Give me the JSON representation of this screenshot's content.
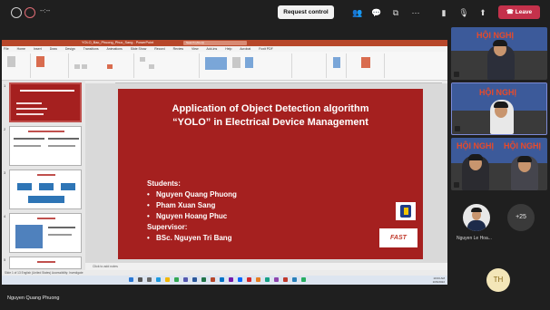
{
  "meeting": {
    "timer": "--:--",
    "request_control_label": "Request control",
    "leave_label": "Leave",
    "presenter_name": "Nguyen Quang Phuong"
  },
  "powerpoint": {
    "window_title": "YOLO_Bao_Phuong_Phuc_Sang - PowerPoint",
    "search_placeholder": "Search (Alt+Q)",
    "tabs": [
      "File",
      "Home",
      "Insert",
      "Draw",
      "Design",
      "Transitions",
      "Animations",
      "Slide Show",
      "Record",
      "Review",
      "View",
      "Add-ins",
      "Help",
      "Acrobat",
      "Foxit PDF"
    ],
    "notes_placeholder": "Click to add notes",
    "status_left": "Slide 1 of 13   English (United States)   Accessibility: Investigate",
    "clock_time": "10:03 AM",
    "clock_date": "10/6/2022"
  },
  "slide": {
    "title_line1": "Application of Object Detection algorithm",
    "title_line2": "“YOLO” in Electrical Device Management",
    "students_label": "Students:",
    "students": [
      "Nguyen Quang Phuong",
      "Pham Xuan Sang",
      "Nguyen Hoang Phuc"
    ],
    "supervisor_label": "Supervisor:",
    "supervisor": "BSc. Nguyen Tri Bang",
    "logo_text": "FAST"
  },
  "thumbnails": [
    {
      "num": "1"
    },
    {
      "num": "2"
    },
    {
      "num": "3"
    },
    {
      "num": "4"
    },
    {
      "num": "5"
    }
  ],
  "participants": {
    "tile_banner": "HỘI NGHỊ",
    "more_count": "+25",
    "attendee_name": "Nguyen Le Hoa...",
    "initials": "TH"
  },
  "colors": {
    "slide_background": "#a5201f",
    "leave_button": "#c4314b",
    "powerpoint_accent": "#b7472a"
  }
}
